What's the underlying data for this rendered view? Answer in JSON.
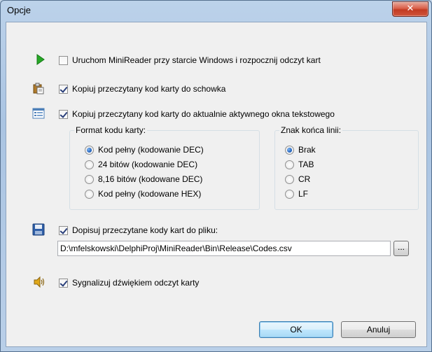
{
  "window": {
    "title": "Opcje",
    "close_glyph": "✕"
  },
  "options": {
    "autostart_label": "Uruchom MiniReader przy starcie Windows i rozpocznij odczyt kart",
    "autostart_checked": false,
    "clipboard_label": "Kopiuj przeczytany kod karty do schowka",
    "clipboard_checked": true,
    "active_window_label": "Kopiuj przeczytany kod karty do aktualnie aktywnego okna tekstowego",
    "active_window_checked": true
  },
  "format_group": {
    "label": "Format kodu karty:",
    "options": [
      {
        "label": "Kod pełny (kodowanie DEC)",
        "selected": true
      },
      {
        "label": "24 bitów (kodowanie DEC)",
        "selected": false
      },
      {
        "label": "8,16 bitów (kodowane DEC)",
        "selected": false
      },
      {
        "label": "Kod pełny (kodowane HEX)",
        "selected": false
      }
    ]
  },
  "line_end_group": {
    "label": "Znak końca linii:",
    "options": [
      {
        "label": "Brak",
        "selected": true
      },
      {
        "label": "TAB",
        "selected": false
      },
      {
        "label": "CR",
        "selected": false
      },
      {
        "label": "LF",
        "selected": false
      }
    ]
  },
  "file_output": {
    "label": "Dopisuj przeczytane kody kart do pliku:",
    "checked": true,
    "path": "D:\\mfelskowski\\DelphiProj\\MiniReader\\Bin\\Release\\Codes.csv",
    "browse_label": "..."
  },
  "sound": {
    "label": "Sygnalizuj dźwiękiem odczyt karty",
    "checked": true
  },
  "buttons": {
    "ok": "OK",
    "cancel": "Anuluj"
  },
  "icons": [
    "play-icon",
    "clipboard-icon",
    "window-list-icon",
    "save-disk-icon",
    "speaker-icon",
    "close-icon"
  ]
}
